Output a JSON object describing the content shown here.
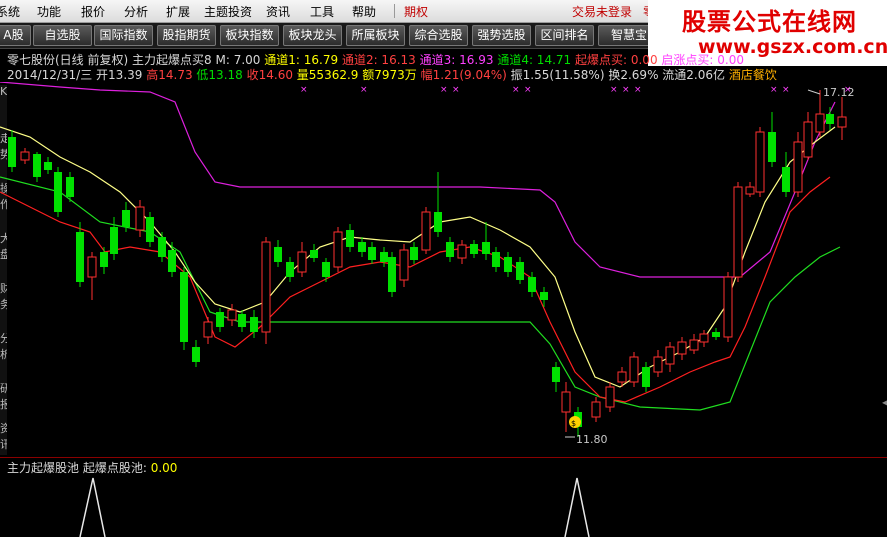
{
  "menu": {
    "items": [
      {
        "label": "系统",
        "red": false
      },
      {
        "label": "功能",
        "red": false
      },
      {
        "label": "报价",
        "red": false
      },
      {
        "label": "分析",
        "red": false
      },
      {
        "label": "扩展",
        "red": false
      },
      {
        "label": "主题投资",
        "red": false
      },
      {
        "label": "资讯",
        "red": false
      },
      {
        "label": "工具",
        "red": false
      },
      {
        "label": "帮助",
        "red": false
      },
      {
        "label": "期权",
        "red": true
      }
    ],
    "trade_status": "交易未登录",
    "trade_extra": "零七"
  },
  "toolbar": {
    "buttons": [
      "A股",
      "自选股",
      "国际指数",
      "股指期货",
      "板块指数",
      "板块龙头",
      "所属板块",
      "综合选股",
      "强势选股",
      "区间排名",
      "智慧宝"
    ]
  },
  "watermark": {
    "title": "股票公式在线网",
    "url": "www.gszx.com.cn"
  },
  "left_tabs": [
    "K",
    "走势",
    "操作",
    "大盘",
    "财务",
    "分析",
    "研报",
    "资讯"
  ],
  "info": {
    "stock": "零七股份(日线 前复权)",
    "indicator": "主力起爆点买8",
    "m": "M: 7.00",
    "ch1": "通道1: 16.79",
    "ch2": "通道2: 16.13",
    "ch3": "通道3: 16.93",
    "ch4": "通道4: 14.71",
    "buy": "起爆点买: 0.00",
    "rise": "启涨点买: 0.00",
    "date": "2014/12/31/三",
    "open": "开13.39",
    "high": "高14.73",
    "low": "低13.18",
    "close": "收14.60",
    "vol": "量55362.9",
    "amt": "额7973万",
    "change": "幅1.21(9.04%)",
    "amp": "振1.55(11.58%)",
    "turn": "换2.69%",
    "float": "流通2.06亿",
    "sector": "酒店餐饮"
  },
  "price_labels": {
    "high": "17.12",
    "low": "11.80"
  },
  "sub": {
    "title": "主力起爆股池",
    "label": "起爆点股池:",
    "value": "0.00"
  },
  "colors": {
    "up": "#ff3030",
    "down": "#00e000",
    "ch1": "#ffff66",
    "ch2": "#ff2020",
    "ch3": "#dd20dd",
    "ch4": "#20dd20"
  }
}
